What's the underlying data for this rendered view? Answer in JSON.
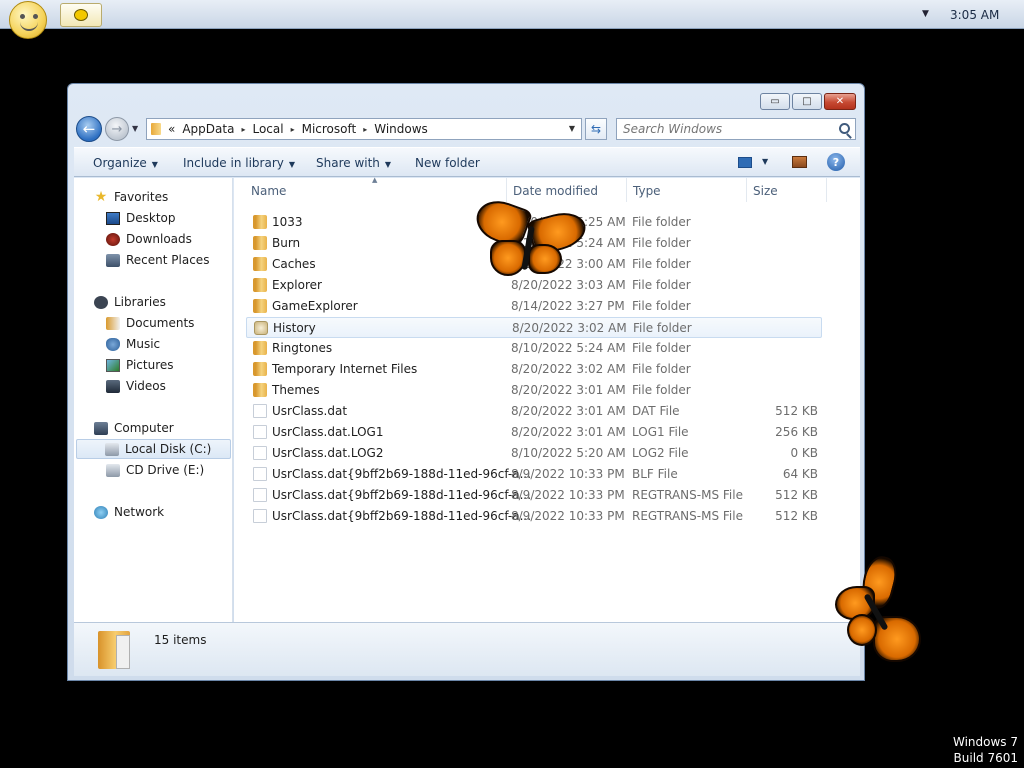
{
  "taskbar": {
    "clock": "3:05 AM",
    "tray_chevron": "▼"
  },
  "window": {
    "minimize_glyph": "▭",
    "maximize_glyph": "□",
    "close_glyph": "✕"
  },
  "address": {
    "overflow": "«",
    "crumbs": [
      "AppData",
      "Local",
      "Microsoft",
      "Windows"
    ],
    "separator": "▸",
    "dropdown": "▼"
  },
  "search": {
    "placeholder": "Search Windows"
  },
  "toolbar": {
    "organize": "Organize",
    "include": "Include in library",
    "share": "Share with",
    "new_folder": "New folder",
    "dropdown": "▼",
    "help": "?"
  },
  "nav": {
    "back": "←",
    "forward": "→",
    "history_dropdown": "▼",
    "refresh": "⇆",
    "favorites": "Favorites",
    "desktop": "Desktop",
    "downloads": "Downloads",
    "recent": "Recent Places",
    "libraries": "Libraries",
    "documents": "Documents",
    "music": "Music",
    "pictures": "Pictures",
    "videos": "Videos",
    "computer": "Computer",
    "local_disk": "Local Disk (C:)",
    "cd_drive": "CD Drive (E:)",
    "network": "Network"
  },
  "columns": {
    "name": "Name",
    "date": "Date modified",
    "type": "Type",
    "size": "Size",
    "sort_arrow": "▲"
  },
  "files": [
    {
      "name": "1033",
      "date": "8/10/2022 5:25 AM",
      "type": "File folder",
      "size": "",
      "icon": "folder"
    },
    {
      "name": "Burn",
      "date": "8/10/2022 5:24 AM",
      "type": "File folder",
      "size": "",
      "icon": "folder"
    },
    {
      "name": "Caches",
      "date": "8/10/2022 3:00 AM",
      "type": "File folder",
      "size": "",
      "icon": "folder"
    },
    {
      "name": "Explorer",
      "date": "8/20/2022 3:03 AM",
      "type": "File folder",
      "size": "",
      "icon": "folder"
    },
    {
      "name": "GameExplorer",
      "date": "8/14/2022 3:27 PM",
      "type": "File folder",
      "size": "",
      "icon": "folder"
    },
    {
      "name": "History",
      "date": "8/20/2022 3:02 AM",
      "type": "File folder",
      "size": "",
      "icon": "history-folder"
    },
    {
      "name": "Ringtones",
      "date": "8/10/2022 5:24 AM",
      "type": "File folder",
      "size": "",
      "icon": "folder"
    },
    {
      "name": "Temporary Internet Files",
      "date": "8/20/2022 3:02 AM",
      "type": "File folder",
      "size": "",
      "icon": "folder"
    },
    {
      "name": "Themes",
      "date": "8/20/2022 3:01 AM",
      "type": "File folder",
      "size": "",
      "icon": "folder"
    },
    {
      "name": "UsrClass.dat",
      "date": "8/20/2022 3:01 AM",
      "type": "DAT File",
      "size": "512 KB",
      "icon": "file"
    },
    {
      "name": "UsrClass.dat.LOG1",
      "date": "8/20/2022 3:01 AM",
      "type": "LOG1 File",
      "size": "256 KB",
      "icon": "file"
    },
    {
      "name": "UsrClass.dat.LOG2",
      "date": "8/10/2022 5:20 AM",
      "type": "LOG2 File",
      "size": "0 KB",
      "icon": "file"
    },
    {
      "name": "UsrClass.dat{9bff2b69-188d-11ed-96cf-a...",
      "date": "8/9/2022 10:33 PM",
      "type": "BLF File",
      "size": "64 KB",
      "icon": "file"
    },
    {
      "name": "UsrClass.dat{9bff2b69-188d-11ed-96cf-a...",
      "date": "8/9/2022 10:33 PM",
      "type": "REGTRANS-MS File",
      "size": "512 KB",
      "icon": "file"
    },
    {
      "name": "UsrClass.dat{9bff2b69-188d-11ed-96cf-a...",
      "date": "8/9/2022 10:33 PM",
      "type": "REGTRANS-MS File",
      "size": "512 KB",
      "icon": "file"
    }
  ],
  "status": {
    "item_count": "15 items"
  },
  "watermark": {
    "line1": "Windows 7",
    "line2": "Build 7601"
  }
}
